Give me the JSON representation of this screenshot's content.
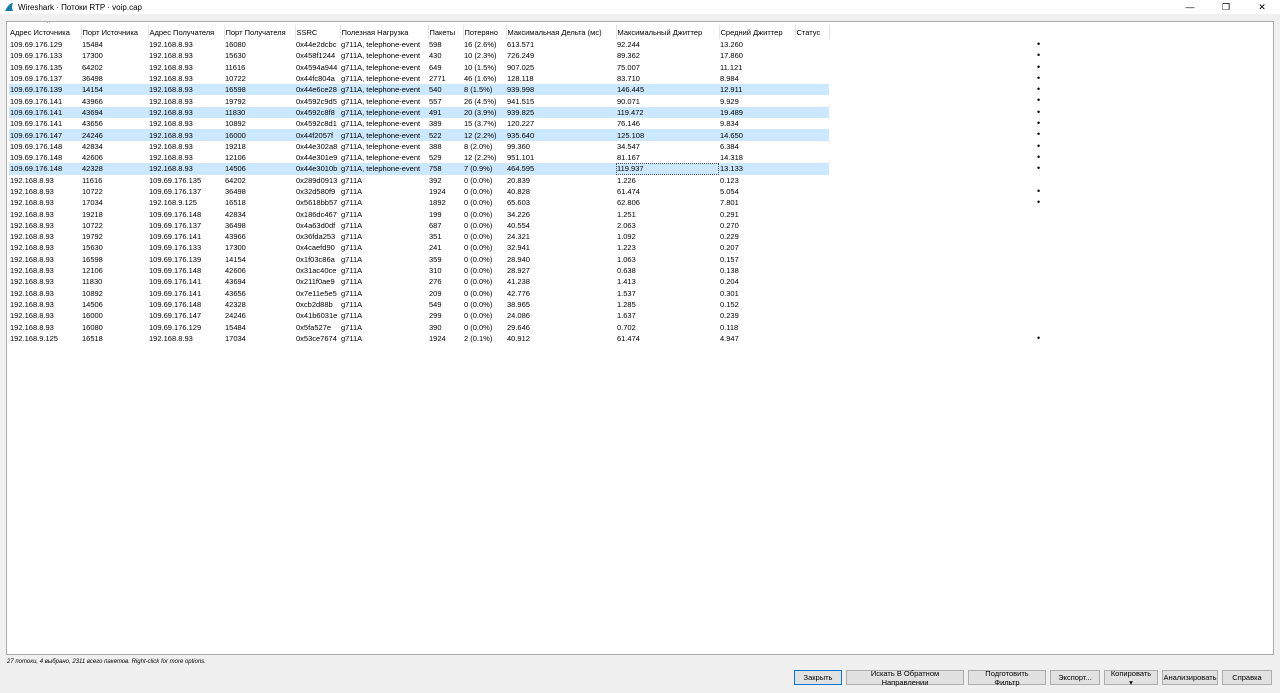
{
  "window": {
    "title": "Wireshark · Потоки RTP · voip.cap",
    "icon": "wireshark-fin-icon",
    "minimize": "—",
    "maximize": "❐",
    "close": "✕"
  },
  "columns": [
    "Адрес Источника",
    "Порт Источника",
    "Адрес Получателя",
    "Порт Получателя",
    "SSRC",
    "Полезная Нагрузка",
    "Пакеты",
    "Потеряно",
    "Максимальная Дельта (мс)",
    "Максимальный Джиттер",
    "Средний Джиттер",
    "Статус"
  ],
  "rows": [
    [
      "109.69.176.129",
      "15484",
      "192.168.8.93",
      "16080",
      "0x44e2dcbc",
      "g711A, telephone-event",
      "598",
      "16 (2.6%)",
      "613.571",
      "92.244",
      "13.260",
      "•"
    ],
    [
      "109.69.176.133",
      "17300",
      "192.168.8.93",
      "15630",
      "0x458f1244",
      "g711A, telephone-event",
      "430",
      "10 (2.3%)",
      "726.249",
      "89.362",
      "17.860",
      "•"
    ],
    [
      "109.69.176.135",
      "64202",
      "192.168.8.93",
      "11616",
      "0x4594a944",
      "g711A, telephone-event",
      "649",
      "10 (1.5%)",
      "907.025",
      "75.007",
      "11.121",
      "•"
    ],
    [
      "109.69.176.137",
      "36498",
      "192.168.8.93",
      "10722",
      "0x44fc804a",
      "g711A, telephone-event",
      "2771",
      "46 (1.6%)",
      "128.118",
      "83.710",
      "8.984",
      "•"
    ],
    [
      "109.69.176.139",
      "14154",
      "192.168.8.93",
      "16598",
      "0x44e6ce28",
      "g711A, telephone-event",
      "540",
      "8 (1.5%)",
      "939.998",
      "146.445",
      "12.911",
      "•"
    ],
    [
      "109.69.176.141",
      "43966",
      "192.168.8.93",
      "19792",
      "0x4592c9d5",
      "g711A, telephone-event",
      "557",
      "26 (4.5%)",
      "941.515",
      "90.071",
      "9.929",
      "•"
    ],
    [
      "109.69.176.141",
      "43694",
      "192.168.8.93",
      "11830",
      "0x4592c8f8",
      "g711A, telephone-event",
      "491",
      "20 (3.9%)",
      "939.825",
      "119.472",
      "19.489",
      "•"
    ],
    [
      "109.69.176.141",
      "43656",
      "192.168.8.93",
      "10892",
      "0x4592c8d1",
      "g711A, telephone-event",
      "389",
      "15 (3.7%)",
      "120.227",
      "76.146",
      "9.834",
      "•"
    ],
    [
      "109.69.176.147",
      "24246",
      "192.168.8.93",
      "16000",
      "0x44f2057f",
      "g711A, telephone-event",
      "522",
      "12 (2.2%)",
      "935.640",
      "125.108",
      "14.650",
      "•"
    ],
    [
      "109.69.176.148",
      "42834",
      "192.168.8.93",
      "19218",
      "0x44e302a8",
      "g711A, telephone-event",
      "388",
      "8 (2.0%)",
      "99.360",
      "34.547",
      "6.384",
      "•"
    ],
    [
      "109.69.176.148",
      "42606",
      "192.168.8.93",
      "12106",
      "0x44e301e9",
      "g711A, telephone-event",
      "529",
      "12 (2.2%)",
      "951.101",
      "81.167",
      "14.318",
      "•"
    ],
    [
      "109.69.176.148",
      "42328",
      "192.168.8.93",
      "14506",
      "0x44e3010b",
      "g711A, telephone-event",
      "758",
      "7 (0.9%)",
      "464.595",
      "119.937",
      "13.133",
      "•"
    ],
    [
      "192.168.8.93",
      "11616",
      "109.69.176.135",
      "64202",
      "0x289d0913",
      "g711A",
      "392",
      "0 (0.0%)",
      "20.839",
      "1.226",
      "0.123",
      ""
    ],
    [
      "192.168.8.93",
      "10722",
      "109.69.176.137",
      "36498",
      "0x32d580f9",
      "g711A",
      "1924",
      "0 (0.0%)",
      "40.828",
      "61.474",
      "5.054",
      "•"
    ],
    [
      "192.168.8.93",
      "17034",
      "192.168.9.125",
      "16518",
      "0x5618bb57",
      "g711A",
      "1892",
      "0 (0.0%)",
      "65.603",
      "62.806",
      "7.801",
      "•"
    ],
    [
      "192.168.8.93",
      "19218",
      "109.69.176.148",
      "42834",
      "0x186dc467",
      "g711A",
      "199",
      "0 (0.0%)",
      "34.226",
      "1.251",
      "0.291",
      ""
    ],
    [
      "192.168.8.93",
      "10722",
      "109.69.176.137",
      "36498",
      "0x4a63d0df",
      "g711A",
      "687",
      "0 (0.0%)",
      "40.554",
      "2.063",
      "0.270",
      ""
    ],
    [
      "192.168.8.93",
      "19792",
      "109.69.176.141",
      "43966",
      "0x36fda253",
      "g711A",
      "351",
      "0 (0.0%)",
      "24.321",
      "1.092",
      "0.229",
      ""
    ],
    [
      "192.168.8.93",
      "15630",
      "109.69.176.133",
      "17300",
      "0x4caefd90",
      "g711A",
      "241",
      "0 (0.0%)",
      "32.941",
      "1.223",
      "0.207",
      ""
    ],
    [
      "192.168.8.93",
      "16598",
      "109.69.176.139",
      "14154",
      "0x1f03c86a",
      "g711A",
      "359",
      "0 (0.0%)",
      "28.940",
      "1.063",
      "0.157",
      ""
    ],
    [
      "192.168.8.93",
      "12106",
      "109.69.176.148",
      "42606",
      "0x31ac40ce",
      "g711A",
      "310",
      "0 (0.0%)",
      "28.927",
      "0.638",
      "0.138",
      ""
    ],
    [
      "192.168.8.93",
      "11830",
      "109.69.176.141",
      "43694",
      "0x211f0ae9",
      "g711A",
      "276",
      "0 (0.0%)",
      "41.238",
      "1.413",
      "0.204",
      ""
    ],
    [
      "192.168.8.93",
      "10892",
      "109.69.176.141",
      "43656",
      "0x7e11e5e5",
      "g711A",
      "209",
      "0 (0.0%)",
      "42.776",
      "1.537",
      "0.301",
      ""
    ],
    [
      "192.168.8.93",
      "14506",
      "109.69.176.148",
      "42328",
      "0xcb2d88b",
      "g711A",
      "549",
      "0 (0.0%)",
      "38.965",
      "1.285",
      "0.152",
      ""
    ],
    [
      "192.168.8.93",
      "16000",
      "109.69.176.147",
      "24246",
      "0x41b6031e",
      "g711A",
      "299",
      "0 (0.0%)",
      "24.086",
      "1.637",
      "0.239",
      ""
    ],
    [
      "192.168.8.93",
      "16080",
      "109.69.176.129",
      "15484",
      "0x5fa527e",
      "g711A",
      "390",
      "0 (0.0%)",
      "29.646",
      "0.702",
      "0.118",
      ""
    ],
    [
      "192.168.9.125",
      "16518",
      "192.168.8.93",
      "17034",
      "0x53ce7674",
      "g711A",
      "1924",
      "2 (0.1%)",
      "40.912",
      "61.474",
      "4.947",
      "•"
    ]
  ],
  "selected_rows": [
    4,
    6,
    8,
    11
  ],
  "status_text": "27 потоки, 4 выбрано, 2311 всего пакетов. Right-click for more options.",
  "buttons": {
    "close": "Закрыть",
    "find_reverse": "Искать В Обратном Направлении",
    "prepare_filter": "Подготовить Фильтр",
    "export": "Экспорт...",
    "copy": "Копировать ▾",
    "analyze": "Анализировать",
    "help": "Справка"
  },
  "colors": {
    "selection": "#cce8ff",
    "default_button_border": "#0078d7"
  }
}
